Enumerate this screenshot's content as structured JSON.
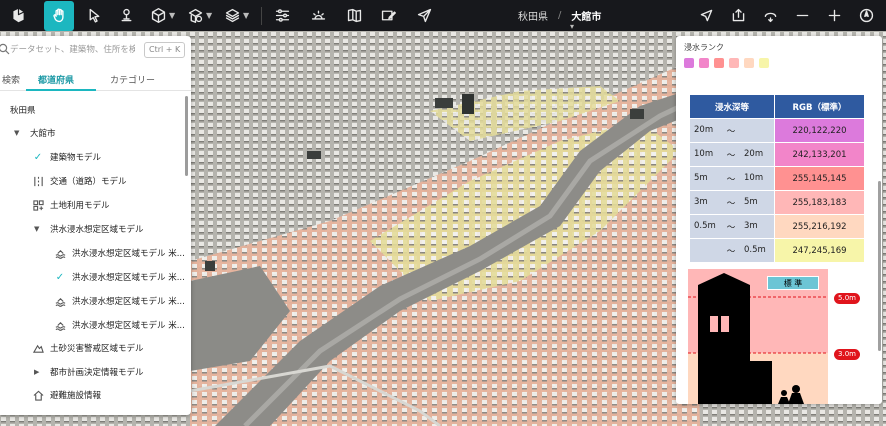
{
  "toolbar": {
    "tools": [
      "logo-icon",
      "hand-icon",
      "pointer-icon",
      "pin-icon",
      "cube-icon",
      "shapes-icon",
      "layers-icon",
      "sliders-icon",
      "sun-horizon-icon",
      "map-book-icon",
      "edit-map-icon",
      "send-icon"
    ],
    "breadcrumb": {
      "prefecture": "秋田県",
      "separator": "/",
      "city": "大館市"
    },
    "right_tools": [
      "location-arrow-icon",
      "export-icon",
      "rotate-icon",
      "zoom-out-icon",
      "zoom-in-icon",
      "compass-icon"
    ]
  },
  "search": {
    "placeholder": "データセット、建築物、住所を検索",
    "shortcut": "Ctrl + K"
  },
  "tabs": [
    {
      "label": "検索"
    },
    {
      "label": "都道府県",
      "active": true
    },
    {
      "label": "カテゴリー"
    }
  ],
  "tree": {
    "root": "秋田県",
    "city": "大館市",
    "items": [
      {
        "label": "建築物モデル",
        "icon": "check-icon"
      },
      {
        "label": "交通（道路）モデル",
        "icon": "road-icon"
      },
      {
        "label": "土地利用モデル",
        "icon": "landuse-icon"
      },
      {
        "label": "洪水浸水想定区域モデル",
        "icon": "caret-down"
      },
      {
        "label": "洪水浸水想定区域モデル 米...",
        "icon": "flood-icon"
      },
      {
        "label": "洪水浸水想定区域モデル 米...",
        "icon": "check-icon"
      },
      {
        "label": "洪水浸水想定区域モデル 米...",
        "icon": "flood-icon"
      },
      {
        "label": "洪水浸水想定区域モデル 米...",
        "icon": "flood-icon"
      },
      {
        "label": "土砂災害警戒区域モデル",
        "icon": "landslide-icon"
      },
      {
        "label": "都市計画決定情報モデル",
        "icon": "caret-right"
      },
      {
        "label": "避難施設情報",
        "icon": "shelter-icon"
      }
    ]
  },
  "legend": {
    "title": "浸水ランク",
    "swatch_colors": [
      "#dc7adc",
      "#f285c9",
      "#ff9191",
      "#ffb7b7",
      "#ffd8c0",
      "#f7f5a9"
    ],
    "table": {
      "headers": [
        "浸水深等",
        "RGB（標準）"
      ],
      "rows": [
        {
          "from": "20m",
          "tilde": "～",
          "to": "",
          "rgb": "220,122,220",
          "color": "#dc7adc"
        },
        {
          "from": "10m",
          "tilde": "～",
          "to": "20m",
          "rgb": "242,133,201",
          "color": "#f285c9"
        },
        {
          "from": "5m",
          "tilde": "～",
          "to": "10m",
          "rgb": "255,145,145",
          "color": "#ff9191"
        },
        {
          "from": "3m",
          "tilde": "～",
          "to": "5m",
          "rgb": "255,183,183",
          "color": "#ffb7b7"
        },
        {
          "from": "0.5m",
          "tilde": "～",
          "to": "3m",
          "rgb": "255,216,192",
          "color": "#ffd8c0"
        },
        {
          "from": "",
          "tilde": "～",
          "to": "0.5m",
          "rgb": "247,245,169",
          "color": "#f7f5a9"
        }
      ]
    },
    "illustration": {
      "standard_label": "標 準",
      "depth_labels": [
        "5.0m",
        "3.0m"
      ]
    }
  }
}
